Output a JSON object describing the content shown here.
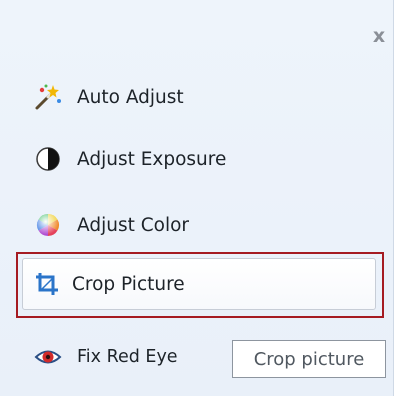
{
  "panel": {
    "close_glyph": "x",
    "items": [
      {
        "label": "Auto Adjust",
        "icon": "magic-wand-icon"
      },
      {
        "label": "Adjust Exposure",
        "icon": "exposure-half-circle-icon"
      },
      {
        "label": "Adjust Color",
        "icon": "color-wheel-icon"
      },
      {
        "label": "Crop Picture",
        "icon": "crop-icon",
        "highlighted": true
      },
      {
        "label": "Fix Red Eye",
        "icon": "red-eye-icon"
      }
    ],
    "highlight_color": "#a51b22"
  },
  "tooltip": {
    "text": "Crop picture"
  }
}
